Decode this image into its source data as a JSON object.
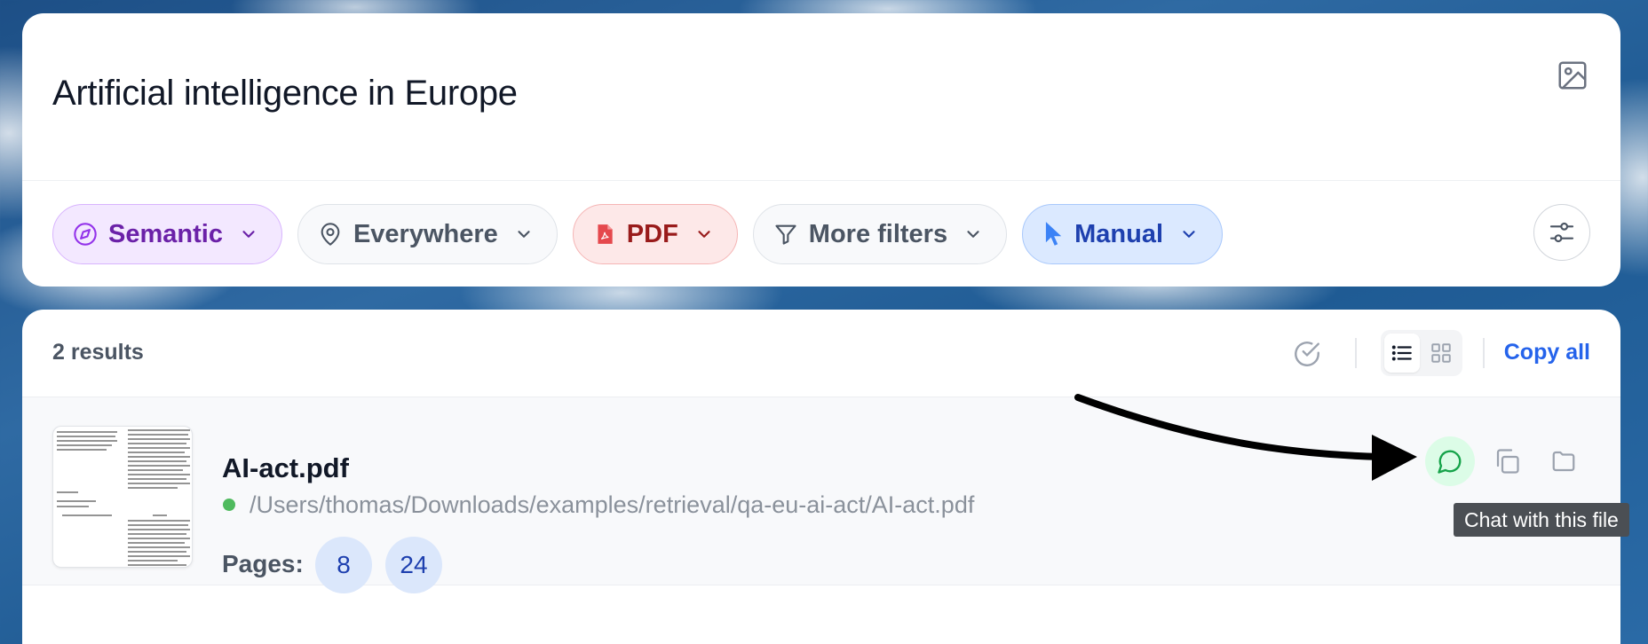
{
  "search": {
    "query": "Artificial intelligence in Europe",
    "image_icon": "image-icon",
    "settings_icon": "sliders-icon"
  },
  "filters": {
    "semantic": {
      "label": "Semantic",
      "icon": "compass-icon",
      "color": "#6b21a8"
    },
    "location": {
      "label": "Everywhere",
      "icon": "map-pin-icon"
    },
    "file_type": {
      "label": "PDF",
      "icon": "pdf-file-icon",
      "color": "#991b1b"
    },
    "more": {
      "label": "More filters",
      "icon": "funnel-icon"
    },
    "mode": {
      "label": "Manual",
      "icon": "cursor-pointer-icon",
      "color": "#1e40af"
    }
  },
  "results": {
    "count_label": "2 results",
    "copy_all_label": "Copy all",
    "view_mode": "list",
    "items": [
      {
        "file_name": "AI-act.pdf",
        "path": "/Users/thomas/Downloads/examples/retrieval/qa-eu-ai-act/AI-act.pdf",
        "status_color": "#4fba5e",
        "pages_label": "Pages:",
        "pages": [
          "8",
          "24"
        ]
      }
    ]
  },
  "tooltip": {
    "text": "Chat with this file"
  }
}
